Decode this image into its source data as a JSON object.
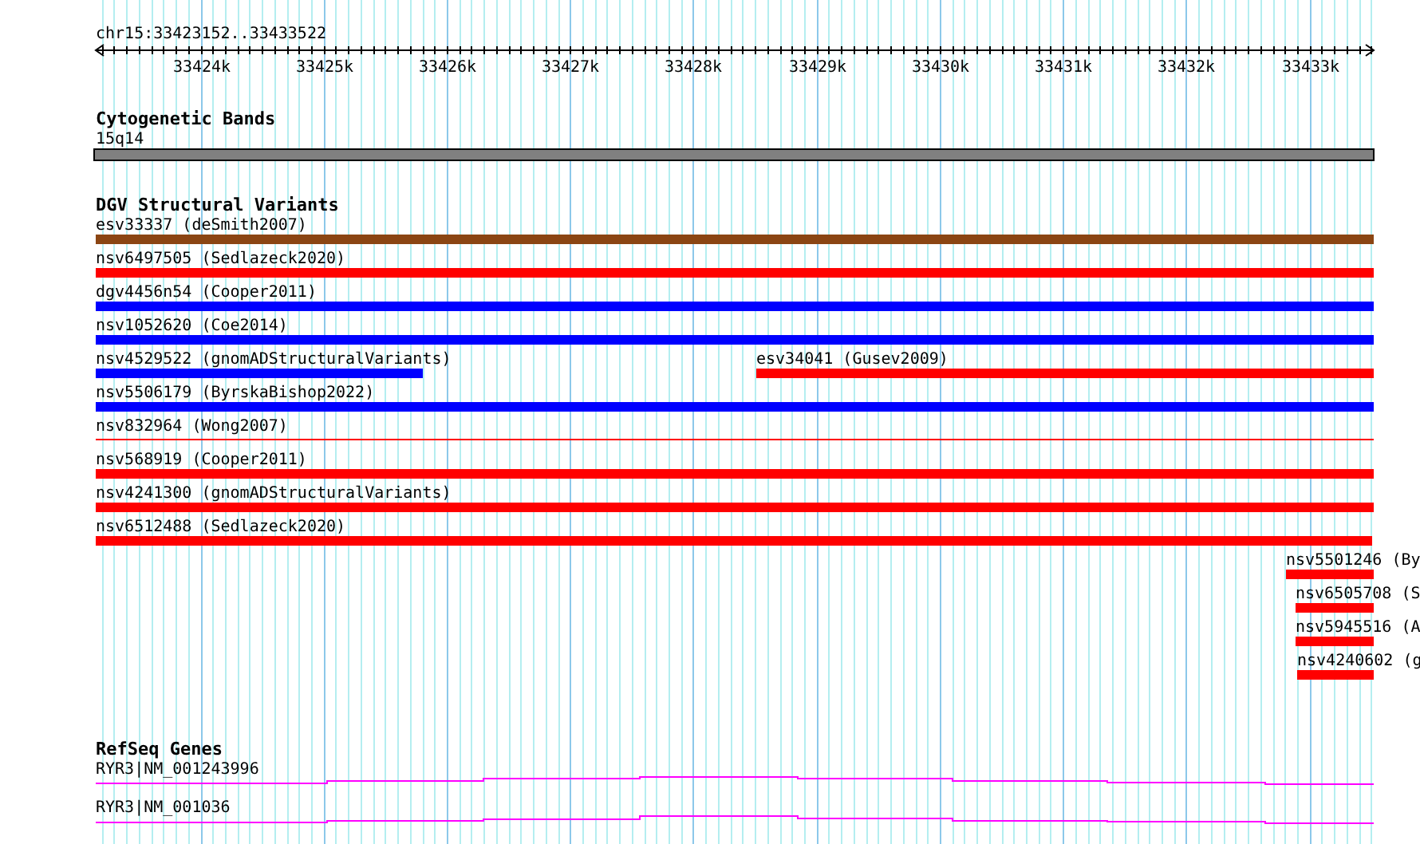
{
  "ruler": {
    "location": "chr15:33423152..33433522",
    "ticks": [
      "33424k",
      "33425k",
      "33426k",
      "33427k",
      "33428k",
      "33429k",
      "33430k",
      "33431k",
      "33432k",
      "33433k"
    ]
  },
  "cytogenetic_bands": {
    "title": "Cytogenetic Bands",
    "band": {
      "label": "15q14",
      "color": "#808080"
    }
  },
  "dgv_structural_variants": {
    "title": "DGV Structural Variants",
    "rows": [
      {
        "features": [
          {
            "label": "esv33337 (deSmith2007)",
            "color": "#8b4513",
            "kind": "bar"
          }
        ]
      },
      {
        "features": [
          {
            "label": "nsv6497505 (Sedlazeck2020)",
            "color": "#ff0000",
            "kind": "bar"
          }
        ]
      },
      {
        "features": [
          {
            "label": "dgv4456n54 (Cooper2011)",
            "color": "#0000ff",
            "kind": "bar"
          }
        ]
      },
      {
        "features": [
          {
            "label": "nsv1052620 (Coe2014)",
            "color": "#0000ff",
            "kind": "bar"
          }
        ]
      },
      {
        "features": [
          {
            "label": "nsv4529522 (gnomADStructuralVariants)",
            "color": "#0000ff",
            "kind": "bar"
          },
          {
            "label": "esv34041 (Gusev2009)",
            "color": "#ff0000",
            "kind": "bar"
          }
        ]
      },
      {
        "features": [
          {
            "label": "nsv5506179 (ByrskaBishop2022)",
            "color": "#0000ff",
            "kind": "bar"
          }
        ]
      },
      {
        "features": [
          {
            "label": "nsv832964 (Wong2007)",
            "color": "#ff0000",
            "kind": "line"
          }
        ]
      },
      {
        "features": [
          {
            "label": "nsv568919 (Cooper2011)",
            "color": "#ff0000",
            "kind": "bar"
          }
        ]
      },
      {
        "features": [
          {
            "label": "nsv4241300 (gnomADStructuralVariants)",
            "color": "#ff0000",
            "kind": "bar"
          }
        ]
      },
      {
        "features": [
          {
            "label": "nsv6512488 (Sedlazeck2020)",
            "color": "#ff0000",
            "kind": "bar"
          }
        ]
      },
      {
        "features": [
          {
            "label": "nsv5501246 (By",
            "color": "#ff0000",
            "kind": "bar"
          }
        ]
      },
      {
        "features": [
          {
            "label": "nsv6505708 (S",
            "color": "#ff0000",
            "kind": "bar"
          }
        ]
      },
      {
        "features": [
          {
            "label": "nsv5945516 (A",
            "color": "#ff0000",
            "kind": "bar"
          }
        ]
      },
      {
        "features": [
          {
            "label": "nsv4240602 (g",
            "color": "#ff0000",
            "kind": "bar"
          }
        ]
      }
    ]
  },
  "refseq_genes": {
    "title": "RefSeq Genes",
    "genes": [
      {
        "label": "RYR3|NM_001243996",
        "color": "#ff00ff"
      },
      {
        "label": "RYR3|NM_001036",
        "color": "#ff00ff"
      }
    ]
  }
}
